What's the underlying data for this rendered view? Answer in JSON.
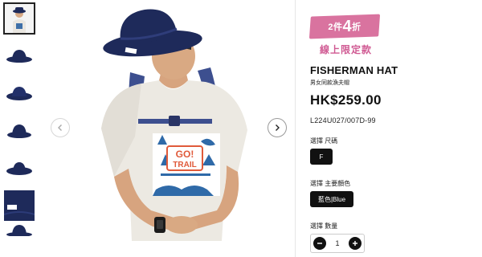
{
  "gallery": {
    "thumbnails": [
      {
        "icon": "model-photo-thumbnail",
        "active": true
      },
      {
        "icon": "hat-side-thumbnail",
        "active": false
      },
      {
        "icon": "hat-front-thumbnail",
        "active": false
      },
      {
        "icon": "hat-back-thumbnail",
        "active": false
      },
      {
        "icon": "hat-top-thumbnail",
        "active": false
      },
      {
        "icon": "hat-detail-thumbnail",
        "active": false
      },
      {
        "icon": "hat-partial-thumbnail",
        "active": false
      }
    ],
    "prev_icon": "chevron-left-icon",
    "next_icon": "chevron-right-icon",
    "shirt_print": {
      "line1": "GO!",
      "line2": "TRAIL"
    }
  },
  "product": {
    "promo": {
      "prefix": "2件",
      "number": "4",
      "suffix": "折"
    },
    "online_only": "線上限定款",
    "title": "FISHERMAN HAT",
    "subtitle": "男女同款漁夫帽",
    "price": "HK$259.00",
    "sku": "L224U027/007D-99",
    "size_label": "選擇 尺碼",
    "size_value": "F",
    "color_label": "選擇 主要顏色",
    "color_value": "藍色|Blue",
    "qty_label": "選擇 數量",
    "qty_value": "1"
  },
  "colors": {
    "navy": "#1e2a5a",
    "promo_pink": "#d9739f",
    "online_pink": "#d05a93",
    "button_black": "#111111"
  }
}
